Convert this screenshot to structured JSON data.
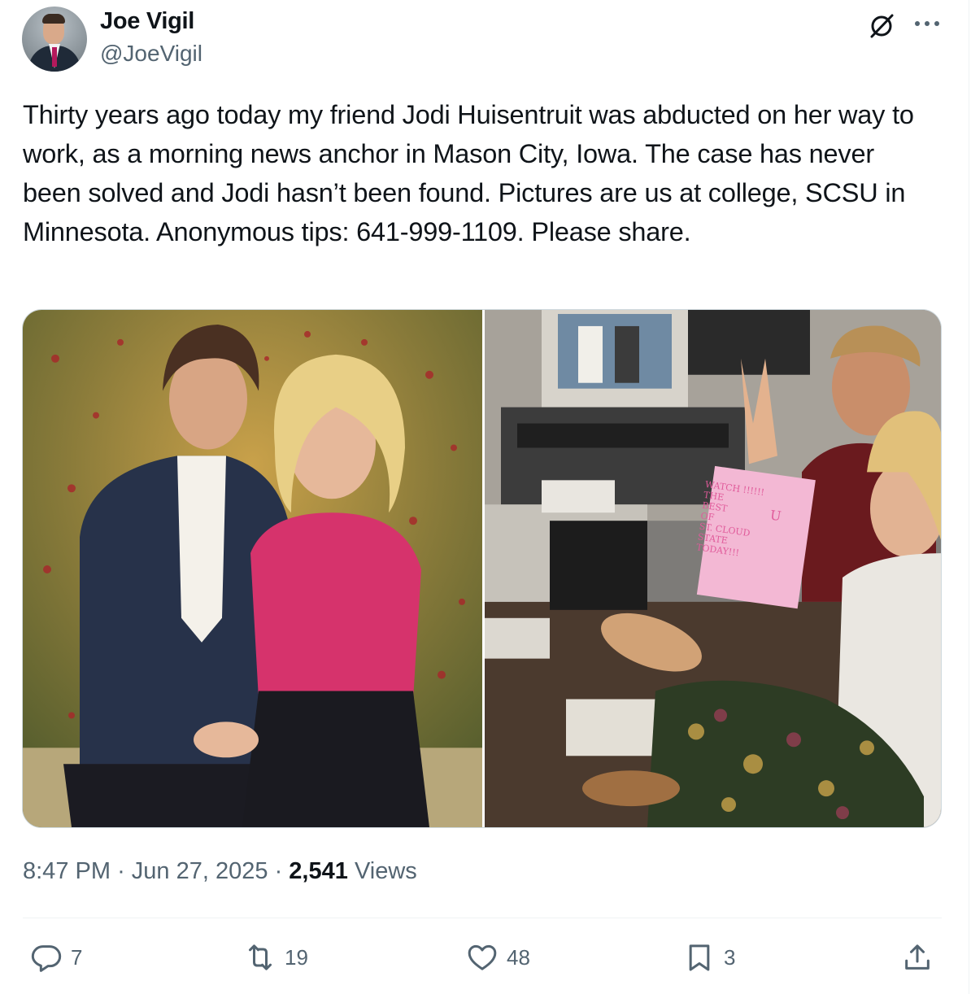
{
  "author": {
    "display_name": "Joe Vigil",
    "handle": "@JoeVigil"
  },
  "tweet": {
    "text": "Thirty years ago today my friend Jodi Huisentruit was abducted on her way to work, as a morning news anchor in Mason City, Iowa. The case has never been solved and Jodi hasn’t been found. Pictures are us at college, SCSU in Minnesota. Anonymous tips: 641-999-1109. Please share.",
    "time": "8:47 PM",
    "separator": "·",
    "date": "Jun 27, 2025",
    "views_count": "2,541",
    "views_label": "Views"
  },
  "media": {
    "photos": [
      {
        "icon": "photo-couple-outdoors"
      },
      {
        "icon": "photo-tv-studio"
      }
    ],
    "sign_text": [
      "WATCH !!!!!!",
      "THE",
      "BEST",
      "OF",
      "ST. CLOUD",
      "STATE",
      "TODAY!!!"
    ],
    "sign_letter": "U"
  },
  "actions": {
    "reply_count": "7",
    "retweet_count": "19",
    "like_count": "48",
    "bookmark_count": "3"
  },
  "icons": [
    "grok-icon",
    "more-icon",
    "reply-icon",
    "retweet-icon",
    "like-icon",
    "bookmark-icon",
    "share-icon"
  ],
  "colors": {
    "text_primary": "#0f1419",
    "text_secondary": "#536471",
    "border": "#cfd9de",
    "divider": "#eff3f4"
  }
}
